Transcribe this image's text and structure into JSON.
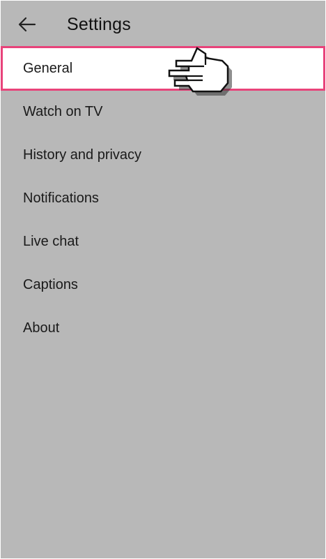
{
  "header": {
    "title": "Settings",
    "back_icon": "arrow-left-icon"
  },
  "settings": {
    "items": [
      {
        "label": "General",
        "highlighted": true
      },
      {
        "label": "Watch on TV"
      },
      {
        "label": "History and privacy"
      },
      {
        "label": "Notifications"
      },
      {
        "label": "Live chat"
      },
      {
        "label": "Captions"
      },
      {
        "label": "About"
      }
    ]
  },
  "overlay": {
    "pointer_icon": "pointing-hand-cursor-icon",
    "highlight_color": "#e8437a"
  },
  "colors": {
    "background": "#b8b8b8",
    "highlight_bg": "#ffffff",
    "text": "#111111"
  }
}
